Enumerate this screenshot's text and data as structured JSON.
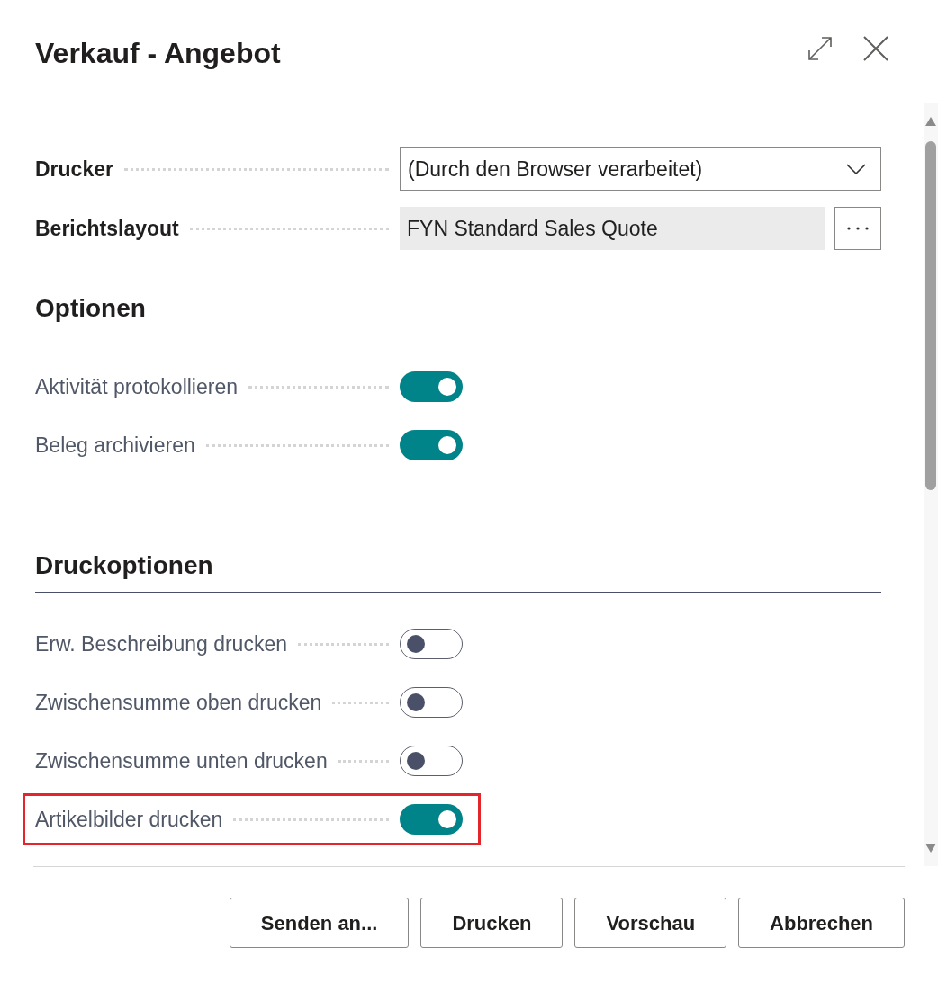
{
  "window": {
    "title": "Verkauf - Angebot"
  },
  "fields": [
    {
      "label": "Drucker",
      "kind": "dropdown",
      "value": "(Durch den Browser verarbeitet)"
    },
    {
      "label": "Berichtslayout",
      "kind": "lookup",
      "value": "FYN Standard Sales Quote"
    }
  ],
  "sections": [
    {
      "title": "Optionen",
      "options": [
        {
          "label": "Aktivität protokollieren",
          "on": true,
          "highlighted": false
        },
        {
          "label": "Beleg archivieren",
          "on": true,
          "highlighted": false
        }
      ]
    },
    {
      "title": "Druckoptionen",
      "options": [
        {
          "label": "Erw. Beschreibung drucken",
          "on": false,
          "highlighted": false
        },
        {
          "label": "Zwischensumme oben drucken",
          "on": false,
          "highlighted": false
        },
        {
          "label": "Zwischensumme unten drucken",
          "on": false,
          "highlighted": false
        },
        {
          "label": "Artikelbilder drucken",
          "on": true,
          "highlighted": true
        }
      ]
    }
  ],
  "buttons": [
    "Senden an...",
    "Drucken",
    "Vorschau",
    "Abbrechen"
  ]
}
